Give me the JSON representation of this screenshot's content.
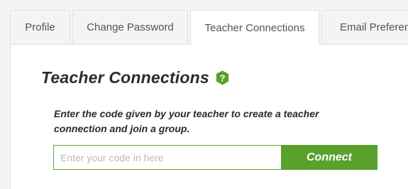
{
  "tabs": [
    {
      "label": "Profile",
      "active": false
    },
    {
      "label": "Change Password",
      "active": false
    },
    {
      "label": "Teacher Connections",
      "active": true
    },
    {
      "label": "Email Preferences",
      "active": false
    }
  ],
  "section": {
    "title": "Teacher Connections",
    "help_icon": "question-mark-shield-icon",
    "instructions": "Enter the code given by your teacher to create a teacher connection and join a group."
  },
  "code_form": {
    "input_value": "",
    "input_placeholder": "Enter your code in here",
    "submit_label": "Connect"
  },
  "colors": {
    "accent_green": "#5aa02c",
    "input_border": "#63a83b",
    "tab_background": "#f4f4f4",
    "heading_text": "#2b2b2b"
  }
}
